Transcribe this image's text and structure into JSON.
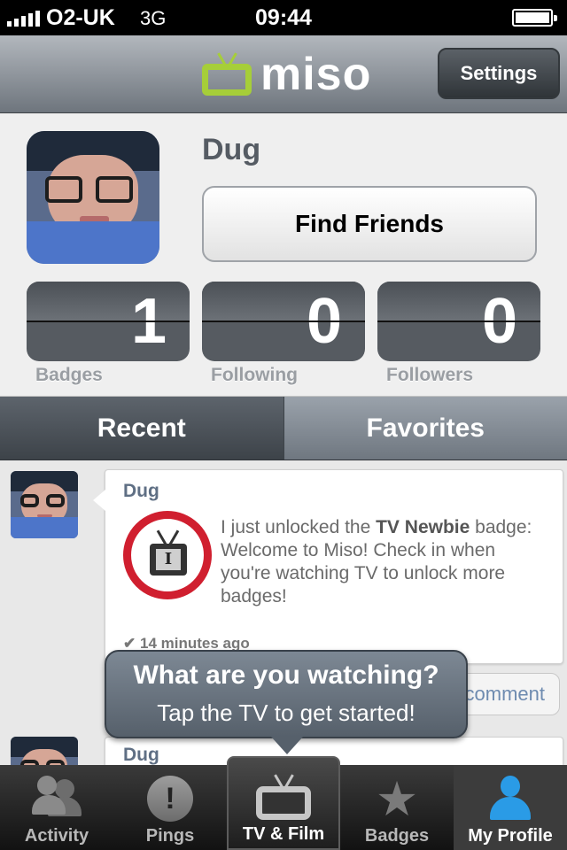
{
  "status_bar": {
    "carrier": "O2-UK",
    "network": "3G",
    "time": "09:44",
    "signal_bars": 5,
    "battery_level": 1.0
  },
  "navbar": {
    "logo_text": "miso",
    "settings_label": "Settings",
    "logo_color": "#a6ce39"
  },
  "profile": {
    "name": "Dug",
    "find_friends_label": "Find Friends",
    "stats": [
      {
        "value": "1",
        "label": "Badges"
      },
      {
        "value": "0",
        "label": "Following"
      },
      {
        "value": "0",
        "label": "Followers"
      }
    ]
  },
  "tabs": {
    "recent": "Recent",
    "favorites": "Favorites",
    "active": "recent"
  },
  "feed": {
    "items": [
      {
        "author": "Dug",
        "message_prefix": "I just unlocked the ",
        "badge_name": "TV Newbie",
        "message_suffix": " badge: Welcome to Miso! Check in when you're watching TV to unlock more badges!",
        "time_ago": "14 minutes ago",
        "badge_icon": "tv-newbie-badge-icon",
        "comment_label": "comment"
      },
      {
        "author": "Dug"
      }
    ]
  },
  "tooltip": {
    "title": "What are you watching?",
    "subtitle": "Tap the TV to get started!"
  },
  "tab_bar": {
    "items": [
      {
        "label": "Activity",
        "icon": "people-icon"
      },
      {
        "label": "Pings",
        "icon": "exclamation-icon"
      },
      {
        "label": "TV & Film",
        "icon": "tv-icon"
      },
      {
        "label": "Badges",
        "icon": "star-badge-icon"
      },
      {
        "label": "My Profile",
        "icon": "user-icon"
      }
    ],
    "selected": "My Profile",
    "accent": "#2a9be6"
  }
}
